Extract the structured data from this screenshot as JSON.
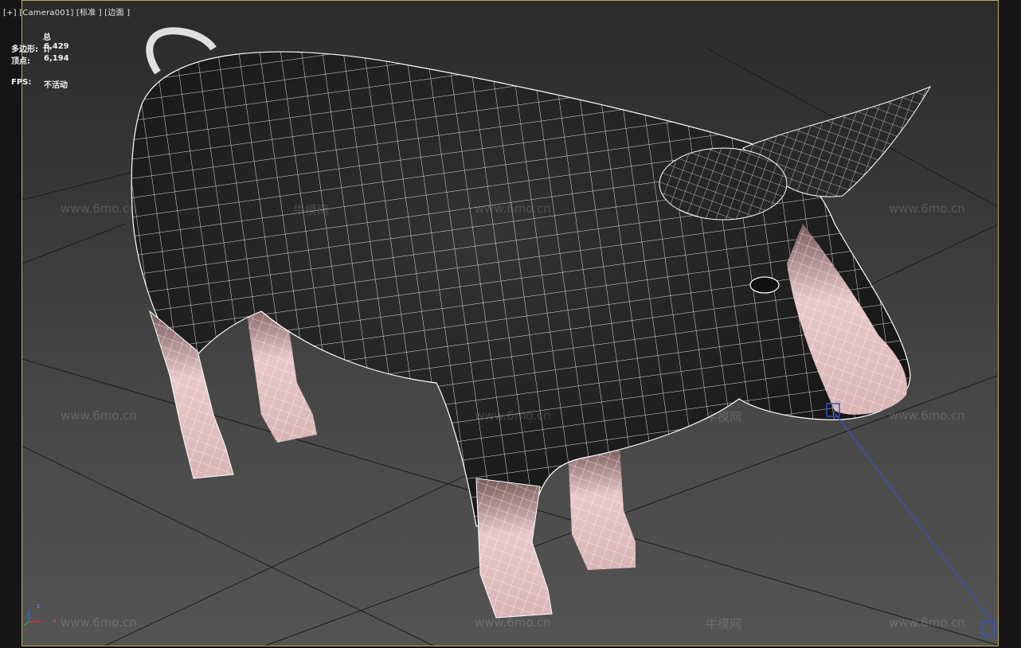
{
  "viewport": {
    "label_plus": "[+]",
    "label_camera": "[Camera001]",
    "label_shading": "[标准 ]",
    "label_edges": "[边面 ]"
  },
  "stats": {
    "header": "总计",
    "poly_label": "多边形:",
    "poly_value": "6,429",
    "vert_label": "顶点:",
    "vert_value": "6,194",
    "fps_label": "FPS:",
    "fps_value": "不活动"
  },
  "watermarks": {
    "url": "www.6mo.cn",
    "brand": "牛模网"
  },
  "gizmo": {
    "axis_x": "x",
    "axis_z": "z"
  },
  "colors": {
    "frame": "#b9b24a",
    "wire": "#ffffff",
    "pig_body": "#1e1e1e",
    "skin": "#e7c7c5",
    "camera_line": "#3355cc"
  }
}
